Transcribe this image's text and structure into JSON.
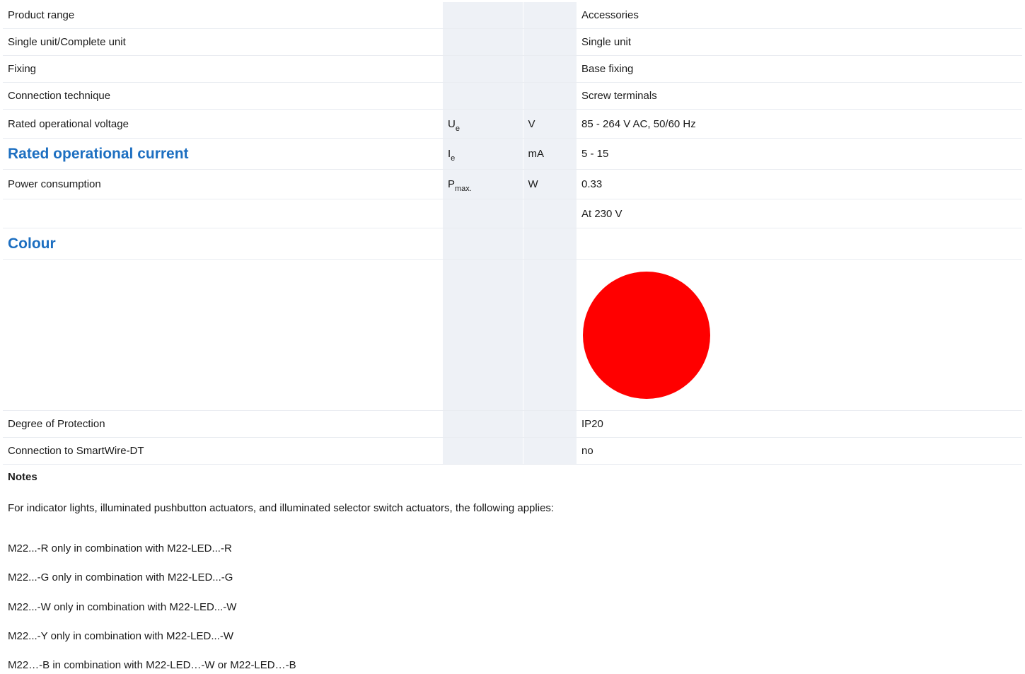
{
  "rows": [
    {
      "label": "Product range",
      "symbol": "",
      "symbol_sub": "",
      "unit": "",
      "value": "Accessories"
    },
    {
      "label": "Single unit/Complete unit",
      "symbol": "",
      "symbol_sub": "",
      "unit": "",
      "value": "Single unit"
    },
    {
      "label": "Fixing",
      "symbol": "",
      "symbol_sub": "",
      "unit": "",
      "value": "Base fixing"
    },
    {
      "label": "Connection technique",
      "symbol": "",
      "symbol_sub": "",
      "unit": "",
      "value": "Screw terminals"
    },
    {
      "label": "Rated operational voltage",
      "symbol": "U",
      "symbol_sub": "e",
      "unit": "V",
      "value": "85 - 264 V AC, 50/60 Hz"
    },
    {
      "label": "Rated operational current",
      "symbol": "I",
      "symbol_sub": "e",
      "unit": "mA",
      "value": "5 - 15"
    },
    {
      "label": "Power consumption",
      "symbol": "P",
      "symbol_sub": "max.",
      "unit": "W",
      "value": "0.33"
    },
    {
      "label": "",
      "symbol": "",
      "symbol_sub": "",
      "unit": "",
      "value": "At 230 V"
    },
    {
      "label": "Colour",
      "symbol": "",
      "symbol_sub": "",
      "unit": "",
      "value": ""
    },
    {
      "label": "Degree of Protection",
      "symbol": "",
      "symbol_sub": "",
      "unit": "",
      "value": "IP20"
    },
    {
      "label": "Connection to SmartWire-DT",
      "symbol": "",
      "symbol_sub": "",
      "unit": "",
      "value": "no"
    }
  ],
  "colour_swatch": "#ff0000",
  "notes": {
    "title": "Notes",
    "lines": [
      "For indicator lights, illuminated pushbutton actuators, and illuminated selector switch actuators, the following applies:",
      "M22...-R only in combination with M22-LED...-R",
      "M22...-G only in combination with M22-LED...-G",
      "M22...-W only in combination with M22-LED...-W",
      "M22...-Y only in combination with M22-LED...-W",
      "M22…-B in combination with M22-LED…-W or M22-LED…-B"
    ]
  }
}
